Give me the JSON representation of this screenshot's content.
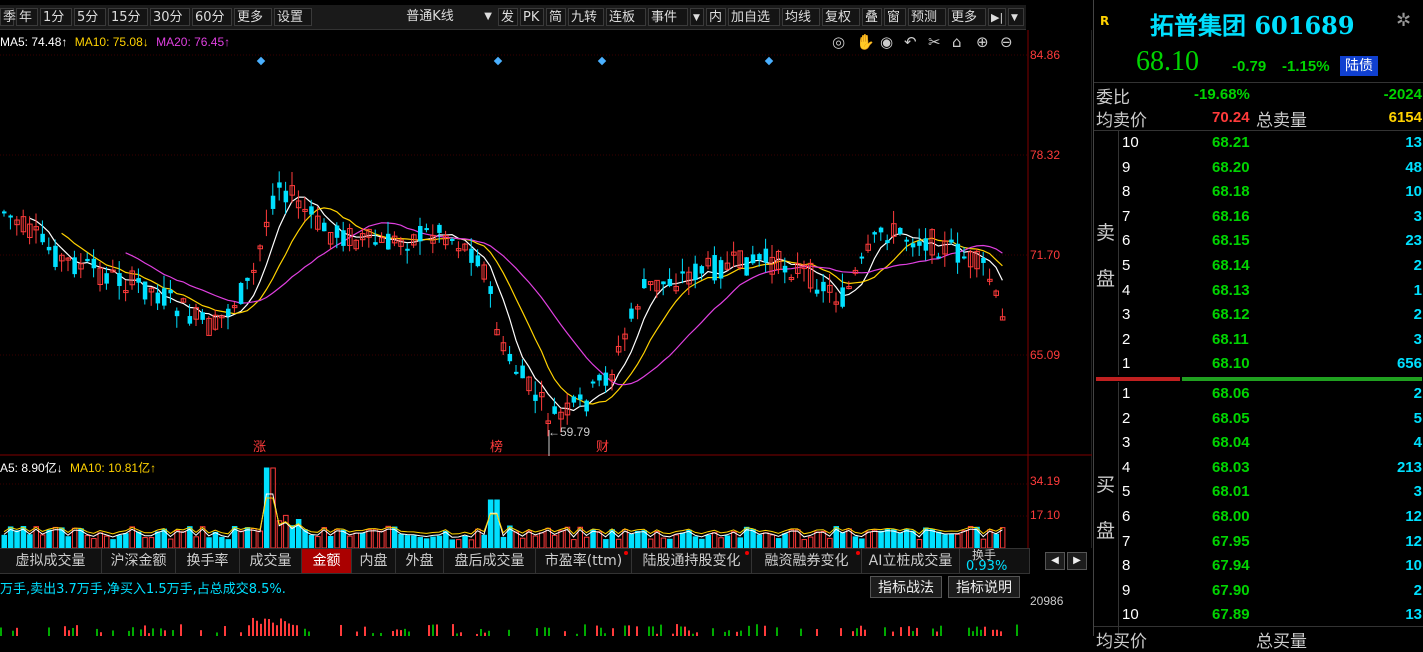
{
  "toolbar": {
    "items": [
      "季",
      "年",
      "1分",
      "5分",
      "15分",
      "30分",
      "60分",
      "更多",
      "设置"
    ],
    "kline_type": "普通K线",
    "right_items": [
      "发",
      "PK",
      "简",
      "九转",
      "连板",
      "事件",
      "内",
      "加自选",
      "均线",
      "复权",
      "叠",
      "窗",
      "预测",
      "更多"
    ]
  },
  "ma_legend": {
    "ma5": "MA5: 74.48↑",
    "ma10": "MA10: 75.08↓",
    "ma20": "MA20: 76.45↑"
  },
  "price_axis": [
    "84.86",
    "78.32",
    "71.70",
    "65.09"
  ],
  "low_label": "←59.79",
  "event_labels": [
    "涨",
    "榜",
    "财"
  ],
  "vol_legend": {
    "ma5": "A5: 8.90亿↓",
    "ma10": "MA10: 10.81亿↑"
  },
  "vol_axis": [
    "34.19",
    "17.10"
  ],
  "tabs": [
    "虚拟成交量",
    "沪深金额",
    "换手率",
    "成交量",
    "金额",
    "内盘",
    "外盘",
    "盘后成交量",
    "市盈率(ttm)",
    "陆股通持股变化",
    "融资融券变化",
    "AI立桩成交量",
    "换手"
  ],
  "turnover_value": "0.93%",
  "info_text": "万手,卖出3.7万手,净买入1.5万手,占总成交8.5%.",
  "buttons": {
    "strategy": "指标战法",
    "explain": "指标说明"
  },
  "bottom_axis_value": "20986",
  "stock": {
    "badge": "R",
    "name": "拓普集团",
    "code": "601689",
    "price": "68.10",
    "change": "-0.79",
    "change_pct": "-1.15%",
    "tag": "陆债"
  },
  "weibi": {
    "label": "委比",
    "pct": "-19.68%",
    "diff": "-2024"
  },
  "avg_sell": {
    "label": "均卖价",
    "price": "70.24",
    "total_label": "总卖量",
    "total": "6154"
  },
  "sell_label": [
    "卖",
    "盘"
  ],
  "buy_label": [
    "买",
    "盘"
  ],
  "sells": [
    {
      "lv": "10",
      "price": "68.21",
      "vol": "13"
    },
    {
      "lv": "9",
      "price": "68.20",
      "vol": "48"
    },
    {
      "lv": "8",
      "price": "68.18",
      "vol": "10"
    },
    {
      "lv": "7",
      "price": "68.16",
      "vol": "3"
    },
    {
      "lv": "6",
      "price": "68.15",
      "vol": "23"
    },
    {
      "lv": "5",
      "price": "68.14",
      "vol": "2"
    },
    {
      "lv": "4",
      "price": "68.13",
      "vol": "1"
    },
    {
      "lv": "3",
      "price": "68.12",
      "vol": "2"
    },
    {
      "lv": "2",
      "price": "68.11",
      "vol": "3"
    },
    {
      "lv": "1",
      "price": "68.10",
      "vol": "656"
    }
  ],
  "buys": [
    {
      "lv": "1",
      "price": "68.06",
      "vol": "2"
    },
    {
      "lv": "2",
      "price": "68.05",
      "vol": "5"
    },
    {
      "lv": "3",
      "price": "68.04",
      "vol": "4"
    },
    {
      "lv": "4",
      "price": "68.03",
      "vol": "213"
    },
    {
      "lv": "5",
      "price": "68.01",
      "vol": "3"
    },
    {
      "lv": "6",
      "price": "68.00",
      "vol": "12"
    },
    {
      "lv": "7",
      "price": "67.95",
      "vol": "12"
    },
    {
      "lv": "8",
      "price": "67.94",
      "vol": "10"
    },
    {
      "lv": "9",
      "price": "67.90",
      "vol": "2"
    },
    {
      "lv": "10",
      "price": "67.89",
      "vol": "13"
    }
  ],
  "bottom_row": {
    "label": "均买价",
    "total_label": "总买量"
  },
  "colors": {
    "up": "#ff3b3b",
    "down": "#00e0ff",
    "ma5": "#ffffff",
    "ma10": "#ffd200",
    "ma20": "#e040e0",
    "green": "#00d400"
  }
}
